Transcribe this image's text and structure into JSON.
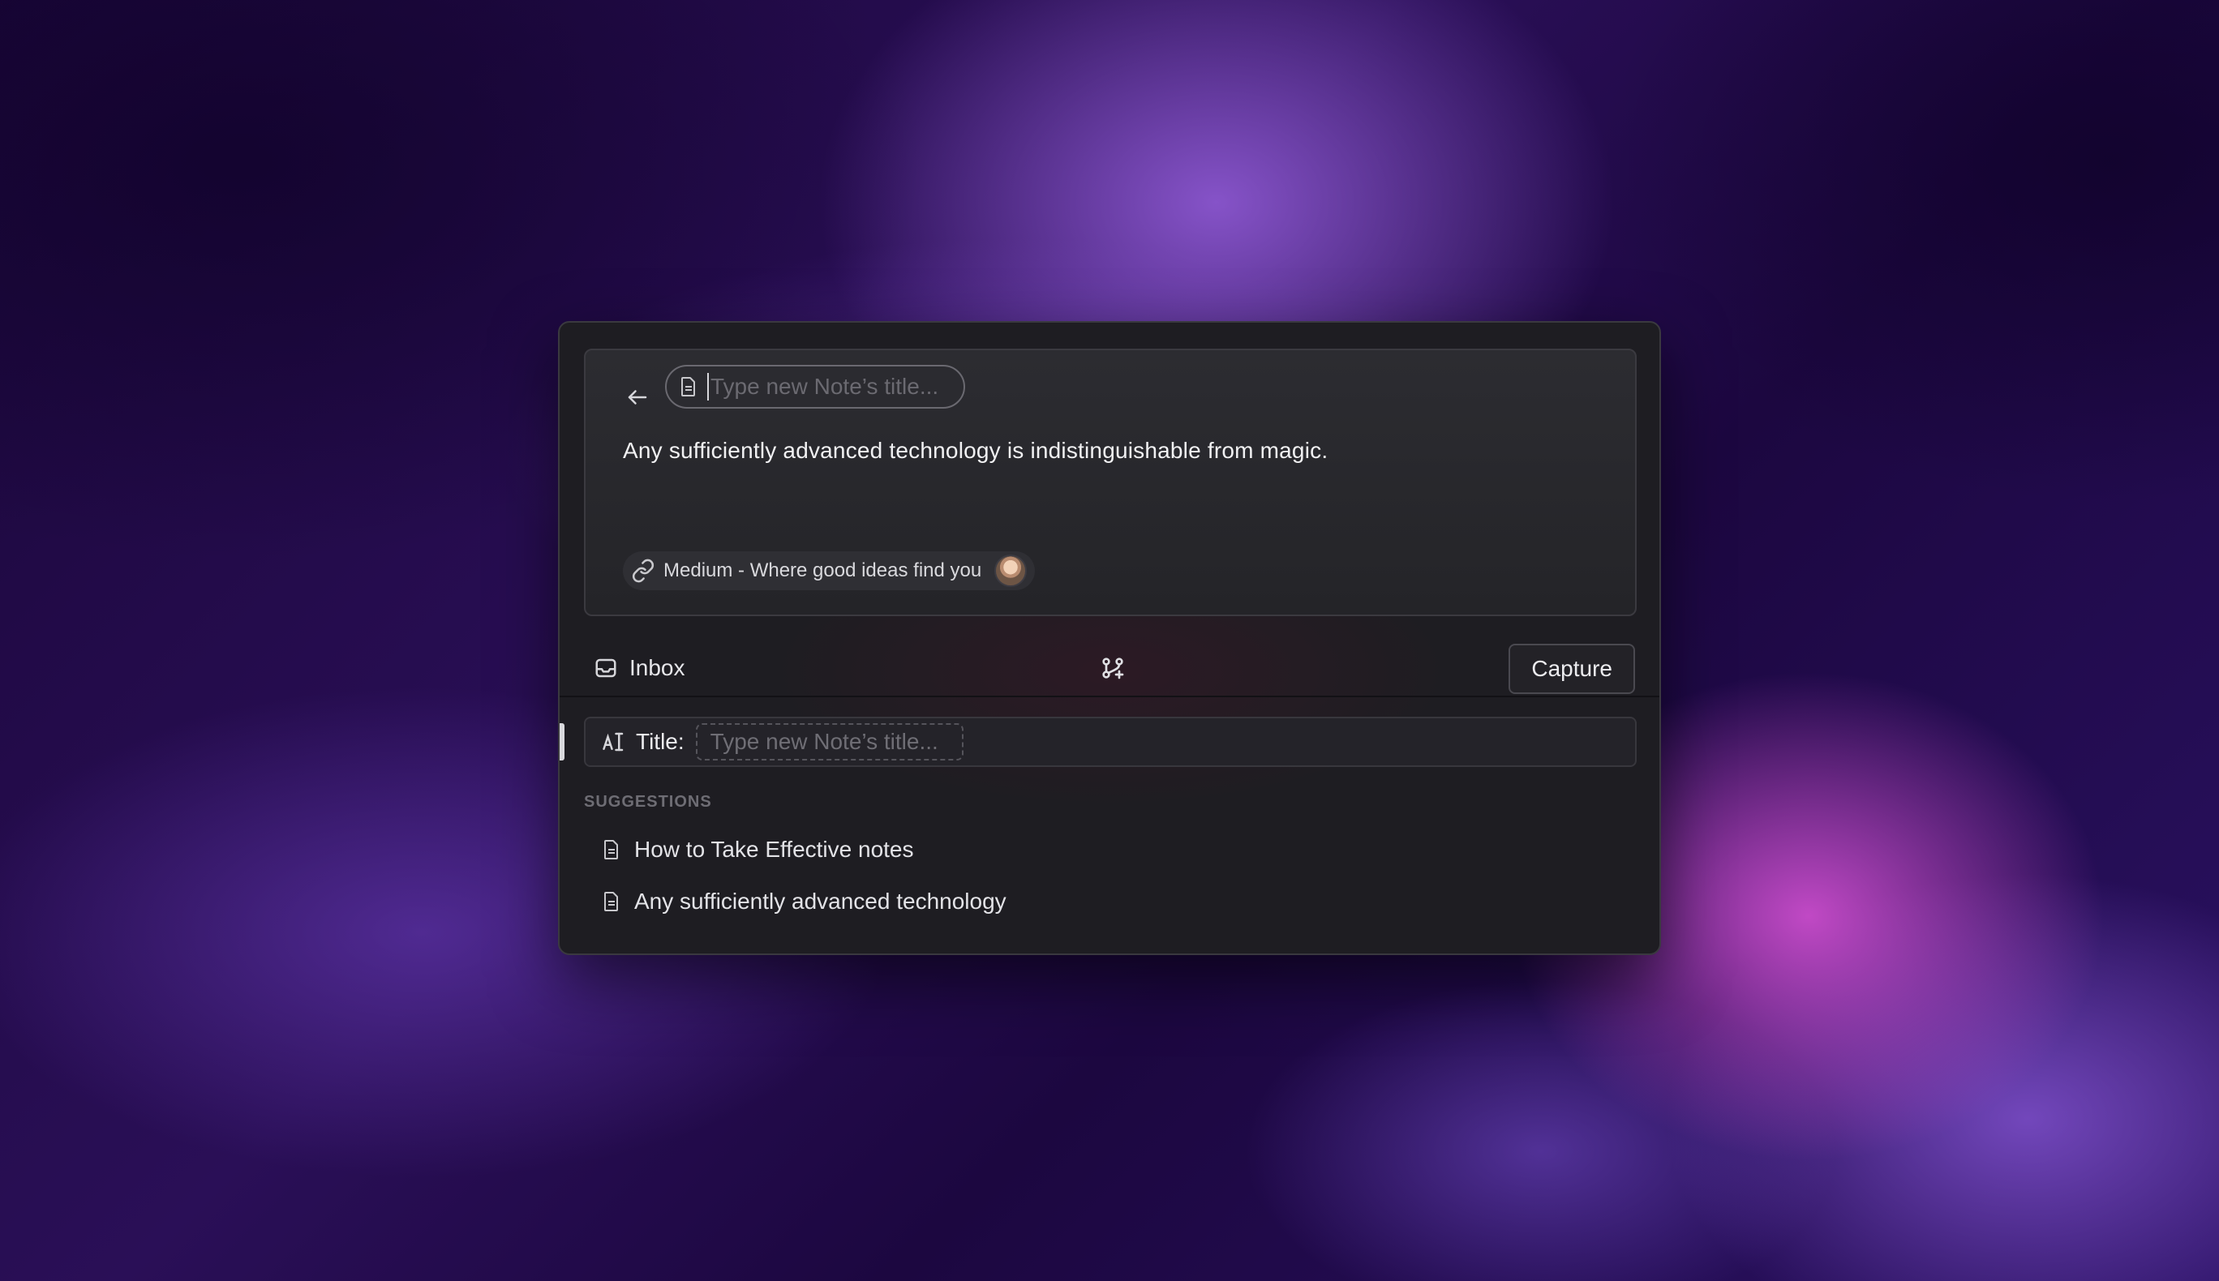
{
  "composer": {
    "title_placeholder": "Type new Note’s title...",
    "body_text": "Any sufficiently advanced technology is indistinguishable from magic.",
    "source_label": "Medium - Where good ideas find you"
  },
  "toolbar": {
    "inbox_label": "Inbox",
    "capture_label": "Capture"
  },
  "title_field": {
    "label": "Title:",
    "placeholder": "Type new Note’s title..."
  },
  "suggestions": {
    "heading": "SUGGESTIONS",
    "items": [
      {
        "label": "How to Take Effective notes"
      },
      {
        "label": "Any sufficiently advanced technology"
      }
    ]
  },
  "icons": {
    "back": "arrow-left-icon",
    "note": "document-icon",
    "link": "link-icon",
    "inbox": "inbox-icon",
    "branch": "branch-icon",
    "title": "text-cursor-icon"
  },
  "colors": {
    "panel_bg": "#1e1d22",
    "card_bg": "#2a2a2f",
    "text": "#f1f1f3",
    "muted": "#6e6d74"
  }
}
